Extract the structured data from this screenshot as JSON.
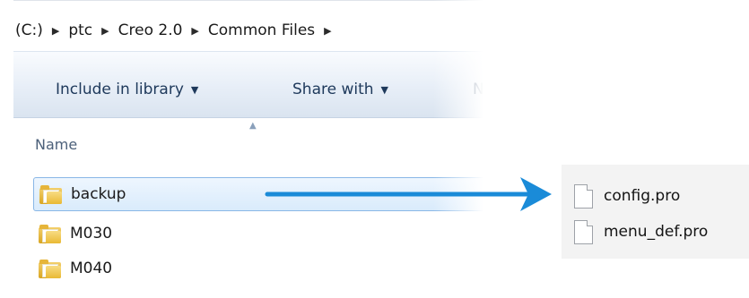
{
  "address_bar": {
    "crumbs": [
      "(C:)",
      "ptc",
      "Creo 2.0",
      "Common Files"
    ]
  },
  "toolbar": {
    "include_label": "Include in library",
    "share_label": "Share with",
    "truncated_label": "Ne"
  },
  "list": {
    "column_name": "Name",
    "folders": [
      {
        "name": "backup",
        "selected": true
      },
      {
        "name": "M030",
        "selected": false
      },
      {
        "name": "M040",
        "selected": false
      }
    ]
  },
  "backup_contents": {
    "files": [
      "config.pro",
      "menu_def.pro"
    ]
  },
  "colors": {
    "arrow": "#1a8bd8",
    "toolbar_text": "#1e395b",
    "selection_border": "#89b7e6"
  }
}
